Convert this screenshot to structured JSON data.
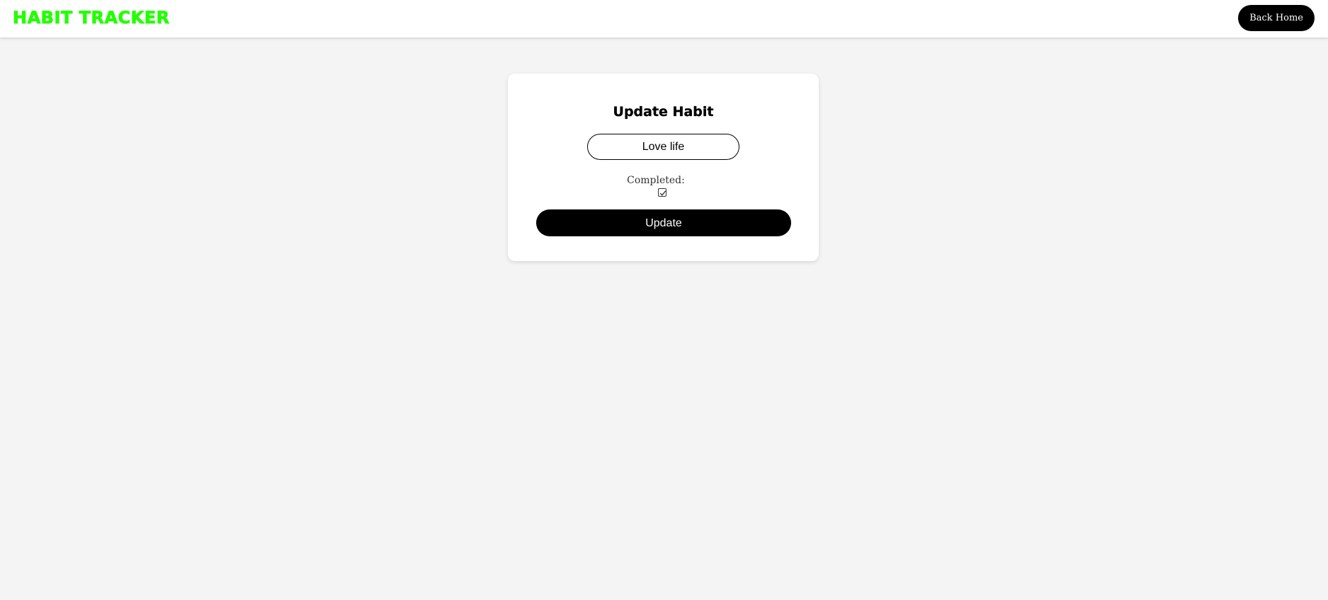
{
  "header": {
    "brand": "HABIT TRACKER",
    "back_home_label": "Back Home"
  },
  "form": {
    "title": "Update Habit",
    "habit_name_value": "Love life",
    "completed_label": "Completed:",
    "completed_checked": true,
    "submit_label": "Update"
  },
  "colors": {
    "brand": "#22ff00",
    "button_bg": "#000000",
    "page_bg": "#f4f4f4"
  }
}
